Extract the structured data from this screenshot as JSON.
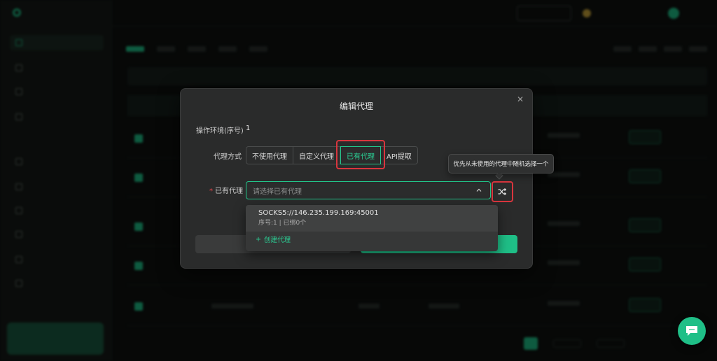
{
  "modal": {
    "title": "编辑代理",
    "env_label": "操作环境(序号)",
    "env_value": "1",
    "proxy_mode_label": "代理方式",
    "proxy_modes": [
      "不使用代理",
      "自定义代理",
      "已有代理",
      "API提取"
    ],
    "existing_proxy_label": "已有代理",
    "select_placeholder": "请选择已有代理",
    "close_icon": "close-icon"
  },
  "dropdown": {
    "option_title": "SOCKS5://146.235.199.169:45001",
    "option_sub": "序号:1 | 已绑0个",
    "create_label": "创建代理"
  },
  "tooltip": {
    "text": "优先从未使用的代理中随机选择一个"
  },
  "colors": {
    "accent": "#1fbf87",
    "highlight_box": "#d9363e",
    "modal_bg": "#2a2b2b"
  },
  "icons": {
    "random": "shuffle-icon",
    "chevron": "chevron-up-icon",
    "plus": "plus-icon",
    "chat": "chat-bubble-icon"
  }
}
